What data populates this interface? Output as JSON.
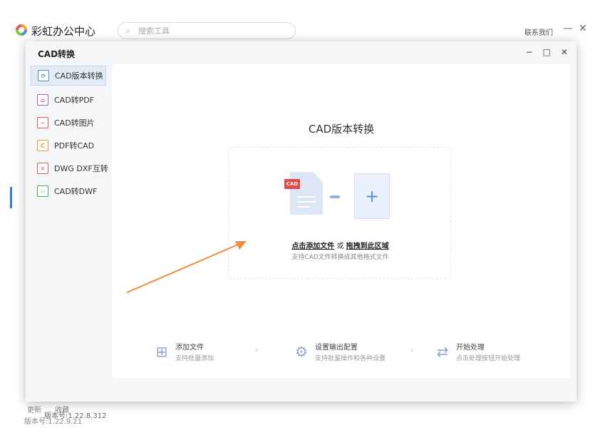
{
  "app": {
    "title": "彩虹办公中心",
    "search_placeholder": "搜索工具",
    "contact": "联系我们",
    "minimize": "—",
    "close": "✕",
    "footer_links": [
      "更新",
      "收藏"
    ],
    "version": "版本号:1.22.9.21"
  },
  "dialog": {
    "title": "CAD转换",
    "controls": {
      "minimize": "−",
      "maximize": "□",
      "close": "✕"
    },
    "version": "版本号:1.22.8.312",
    "sidebar": [
      {
        "label": "CAD版本转换",
        "icon": "refresh-doc-icon",
        "color": "#4a90c8",
        "active": true
      },
      {
        "label": "CAD转PDF",
        "icon": "pdf-doc-icon",
        "color": "#b05ab8",
        "active": false
      },
      {
        "label": "CAD转图片",
        "icon": "image-doc-icon",
        "color": "#e2574c",
        "active": false
      },
      {
        "label": "PDF转CAD",
        "icon": "cad-doc-icon",
        "color": "#e89a2c",
        "active": false
      },
      {
        "label": "DWG DXF互转",
        "icon": "dwg-doc-icon",
        "color": "#e2574c",
        "active": false
      },
      {
        "label": "CAD转DWF",
        "icon": "dwf-doc-icon",
        "color": "#3aa860",
        "active": false
      }
    ],
    "main": {
      "title": "CAD版本转换",
      "cad_tag": "CAD",
      "plus": "+",
      "drop_click": "点击添加文件",
      "drop_or": " 或 ",
      "drop_drag": "拖拽到此区域",
      "drop_sub": "支持CAD文件转换成其他格式文件"
    },
    "steps": [
      {
        "title": "添加文件",
        "desc": "支持批量添加",
        "icon": "add-file-icon"
      },
      {
        "title": "设置输出配置",
        "desc": "支持批量操作和各种设置",
        "icon": "settings-icon"
      },
      {
        "title": "开始处理",
        "desc": "点击处理按钮开始处理",
        "icon": "process-icon"
      }
    ],
    "step_sep": "›"
  },
  "colors": {
    "accent": "#3a7bd5",
    "arrow": "#f08a3c"
  }
}
